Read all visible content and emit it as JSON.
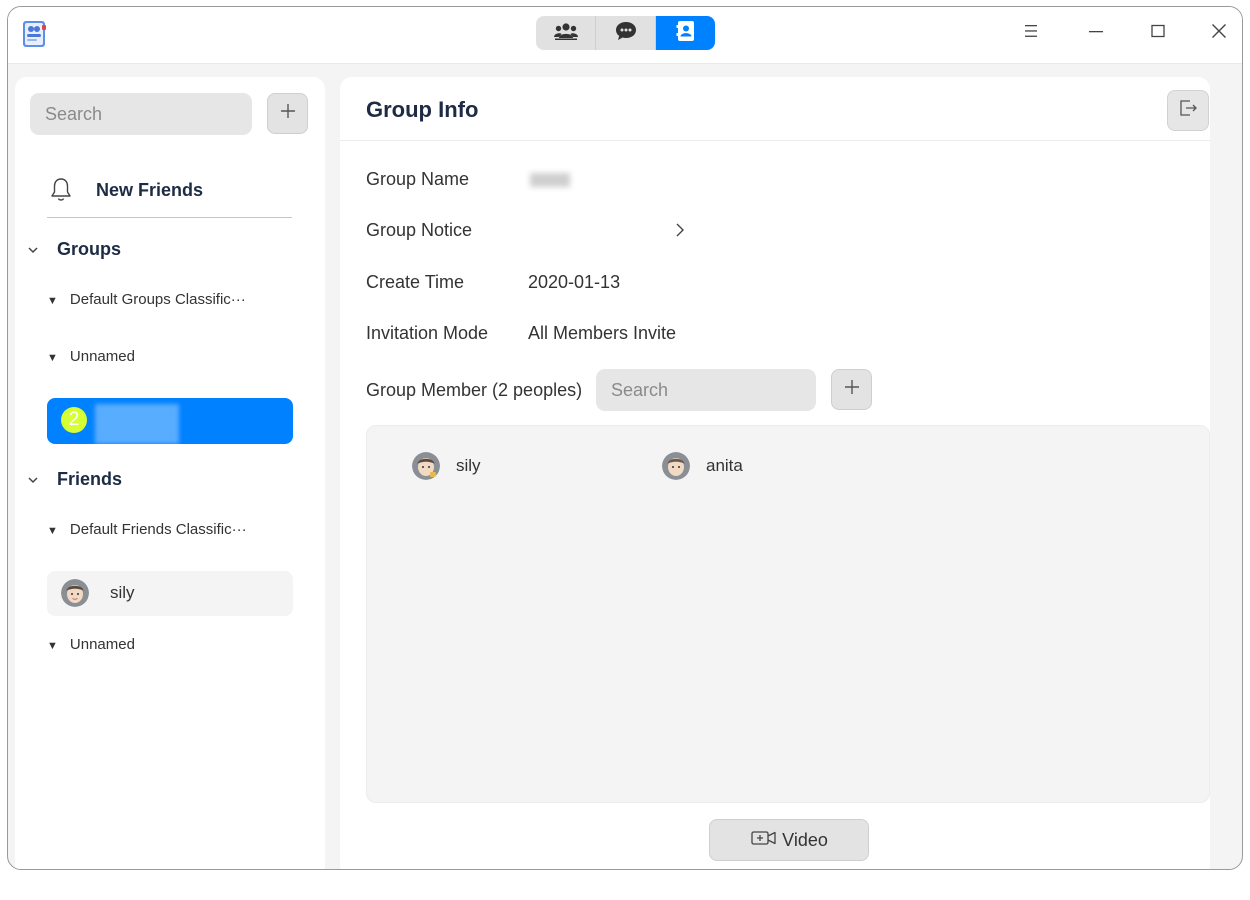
{
  "titlebar": {
    "tabs": [
      {
        "icon": "group-icon",
        "active": false
      },
      {
        "icon": "chat-icon",
        "active": false
      },
      {
        "icon": "contacts-icon",
        "active": true
      }
    ],
    "controls": [
      "menu-icon",
      "minimize-icon",
      "maximize-icon",
      "close-icon"
    ]
  },
  "sidebar": {
    "search_placeholder": "Search",
    "new_friends": "New Friends",
    "groups_title": "Groups",
    "groups": [
      {
        "label": "Default Groups Classific···"
      },
      {
        "label": "Unnamed"
      }
    ],
    "selected_group_badge": "2",
    "friends_title": "Friends",
    "friend_categories": [
      {
        "label": "Default Friends Classific···"
      },
      {
        "label": "Unnamed"
      }
    ],
    "friends": [
      {
        "name": "sily"
      }
    ]
  },
  "group_info": {
    "title": "Group Info",
    "fields": {
      "group_name_label": "Group Name",
      "group_notice_label": "Group Notice",
      "create_time_label": "Create Time",
      "create_time_value": "2020-01-13",
      "invitation_mode_label": "Invitation Mode",
      "invitation_mode_value": "All Members Invite"
    },
    "member_label": "Group Member (2 peoples)",
    "member_search_placeholder": "Search",
    "members": [
      {
        "name": "sily"
      },
      {
        "name": "anita"
      }
    ],
    "video_label": "Video"
  },
  "colors": {
    "accent": "#0081ff",
    "badge": "#d6ff33",
    "panel_bg": "#ffffff",
    "window_bg": "#f4f4f4"
  }
}
